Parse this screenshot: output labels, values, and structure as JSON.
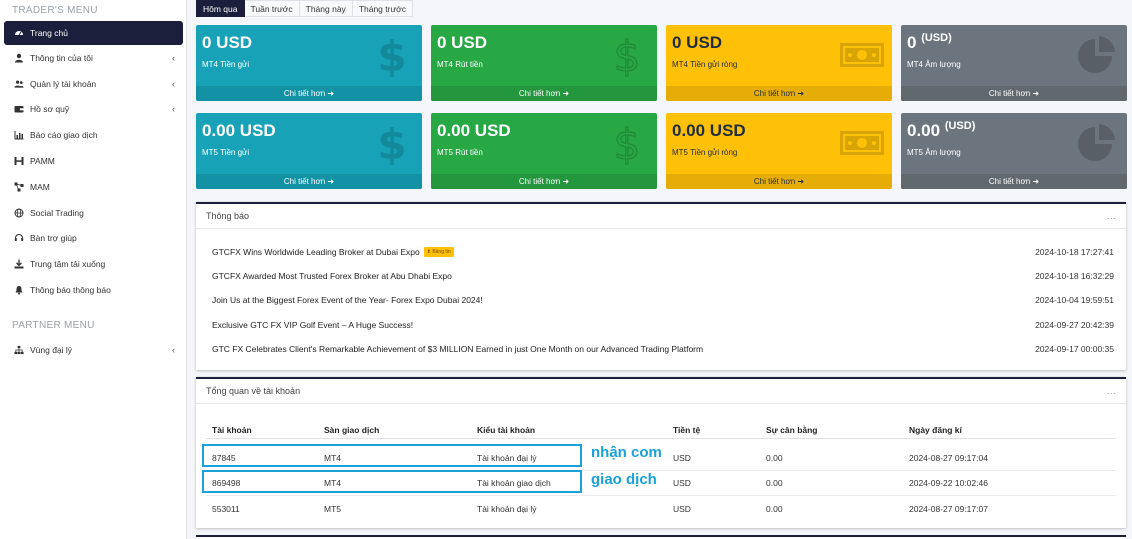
{
  "sidebar": {
    "trader_menu_title": "TRADER'S MENU",
    "partner_menu_title": "PARTNER MENU",
    "items": [
      {
        "label": "Trang chủ",
        "icon": "dashboard-icon"
      },
      {
        "label": "Thông tin của tôi",
        "icon": "user-icon"
      },
      {
        "label": "Quản lý tài khoản",
        "icon": "users-icon"
      },
      {
        "label": "Hồ sơ quỹ",
        "icon": "wallet-icon"
      },
      {
        "label": "Báo cáo giao dịch",
        "icon": "chart-icon"
      },
      {
        "label": "PAMM",
        "icon": "pamm-icon"
      },
      {
        "label": "MAM",
        "icon": "network-icon"
      },
      {
        "label": "Social Trading",
        "icon": "globe-icon"
      },
      {
        "label": "Bàn trợ giúp",
        "icon": "headset-icon"
      },
      {
        "label": "Trung tâm tải xuống",
        "icon": "download-icon"
      },
      {
        "label": "Thông báo thông báo",
        "icon": "bell-icon"
      }
    ],
    "partner_items": [
      {
        "label": "Vùng đại lý",
        "icon": "sitemap-icon"
      }
    ]
  },
  "tabs": [
    "Hôm qua",
    "Tuần trước",
    "Tháng này",
    "Tháng trước"
  ],
  "cards": {
    "mt4_deposit": {
      "value": "0 USD",
      "label": "MT4 Tiền gửi",
      "more": "Chi tiết hơn"
    },
    "mt4_withdraw": {
      "value": "0 USD",
      "label": "MT4 Rút tiền",
      "more": "Chi tiết hơn"
    },
    "mt4_net": {
      "value": "0 USD",
      "label": "MT4 Tiền gửi ròng",
      "more": "Chi tiết hơn"
    },
    "mt4_volume": {
      "value": "0",
      "unit": "(USD)",
      "label": "MT4 Âm lượng",
      "more": "Chi tiết hơn"
    },
    "mt5_deposit": {
      "value": "0.00 USD",
      "label": "MT5 Tiền gửi",
      "more": "Chi tiết hơn"
    },
    "mt5_withdraw": {
      "value": "0.00 USD",
      "label": "MT5 Rút tiền",
      "more": "Chi tiết hơn"
    },
    "mt5_net": {
      "value": "0.00 USD",
      "label": "MT5 Tiền gửi ròng",
      "more": "Chi tiết hơn"
    },
    "mt5_volume": {
      "value": "0.00",
      "unit": "(USD)",
      "label": "MT5 Âm lượng",
      "more": "Chi tiết hơn"
    }
  },
  "notices": {
    "title": "Thông báo",
    "menu": "...",
    "hot_label": "Bảng tin",
    "items": [
      {
        "title": "GTCFX Wins Worldwide Leading Broker at Dubai Expo",
        "date": "2024-10-18 17:27:41"
      },
      {
        "title": "GTCFX Awarded Most Trusted Forex Broker at Abu Dhabi Expo",
        "date": "2024-10-18 16:32:29"
      },
      {
        "title": "Join Us at the Biggest Forex Event of the Year- Forex Expo Dubai 2024!",
        "date": "2024-10-04 19:59:51"
      },
      {
        "title": "Exclusive GTC FX VIP Golf Event – A Huge Success!",
        "date": "2024-09-27 20:42:39"
      },
      {
        "title": "GTC FX Celebrates Client's Remarkable Achievement of $3 MILLION Earned in just One Month on our Advanced Trading Platform",
        "date": "2024-09-17 00:00:35"
      }
    ]
  },
  "overview": {
    "title": "Tổng quan về tài khoản",
    "menu": "...",
    "columns": [
      "Tài khoản",
      "Sàn giao dịch",
      "Kiểu tài khoản",
      "Tiền tệ",
      "Sự cân bằng",
      "Ngày đăng kí"
    ],
    "rows": [
      [
        "87845",
        "MT4",
        "Tài khoản đại lý",
        "USD",
        "0.00",
        "2024-08-27 09:17:04"
      ],
      [
        "869498",
        "MT4",
        "Tài khoản giao dịch",
        "USD",
        "0.00",
        "2024-09-22 10:02:46"
      ],
      [
        "553011",
        "MT5",
        "Tài khoản đại lý",
        "USD",
        "0.00",
        "2024-08-27 09:17:07"
      ]
    ],
    "annotations": [
      "nhận com",
      "giao dịch"
    ]
  },
  "colors": {
    "navy": "#1b1f3b",
    "teal": "#17a2b8",
    "green": "#28a745",
    "yellow": "#ffc107",
    "gray": "#6c757d",
    "annotation": "#1aa1d8"
  }
}
